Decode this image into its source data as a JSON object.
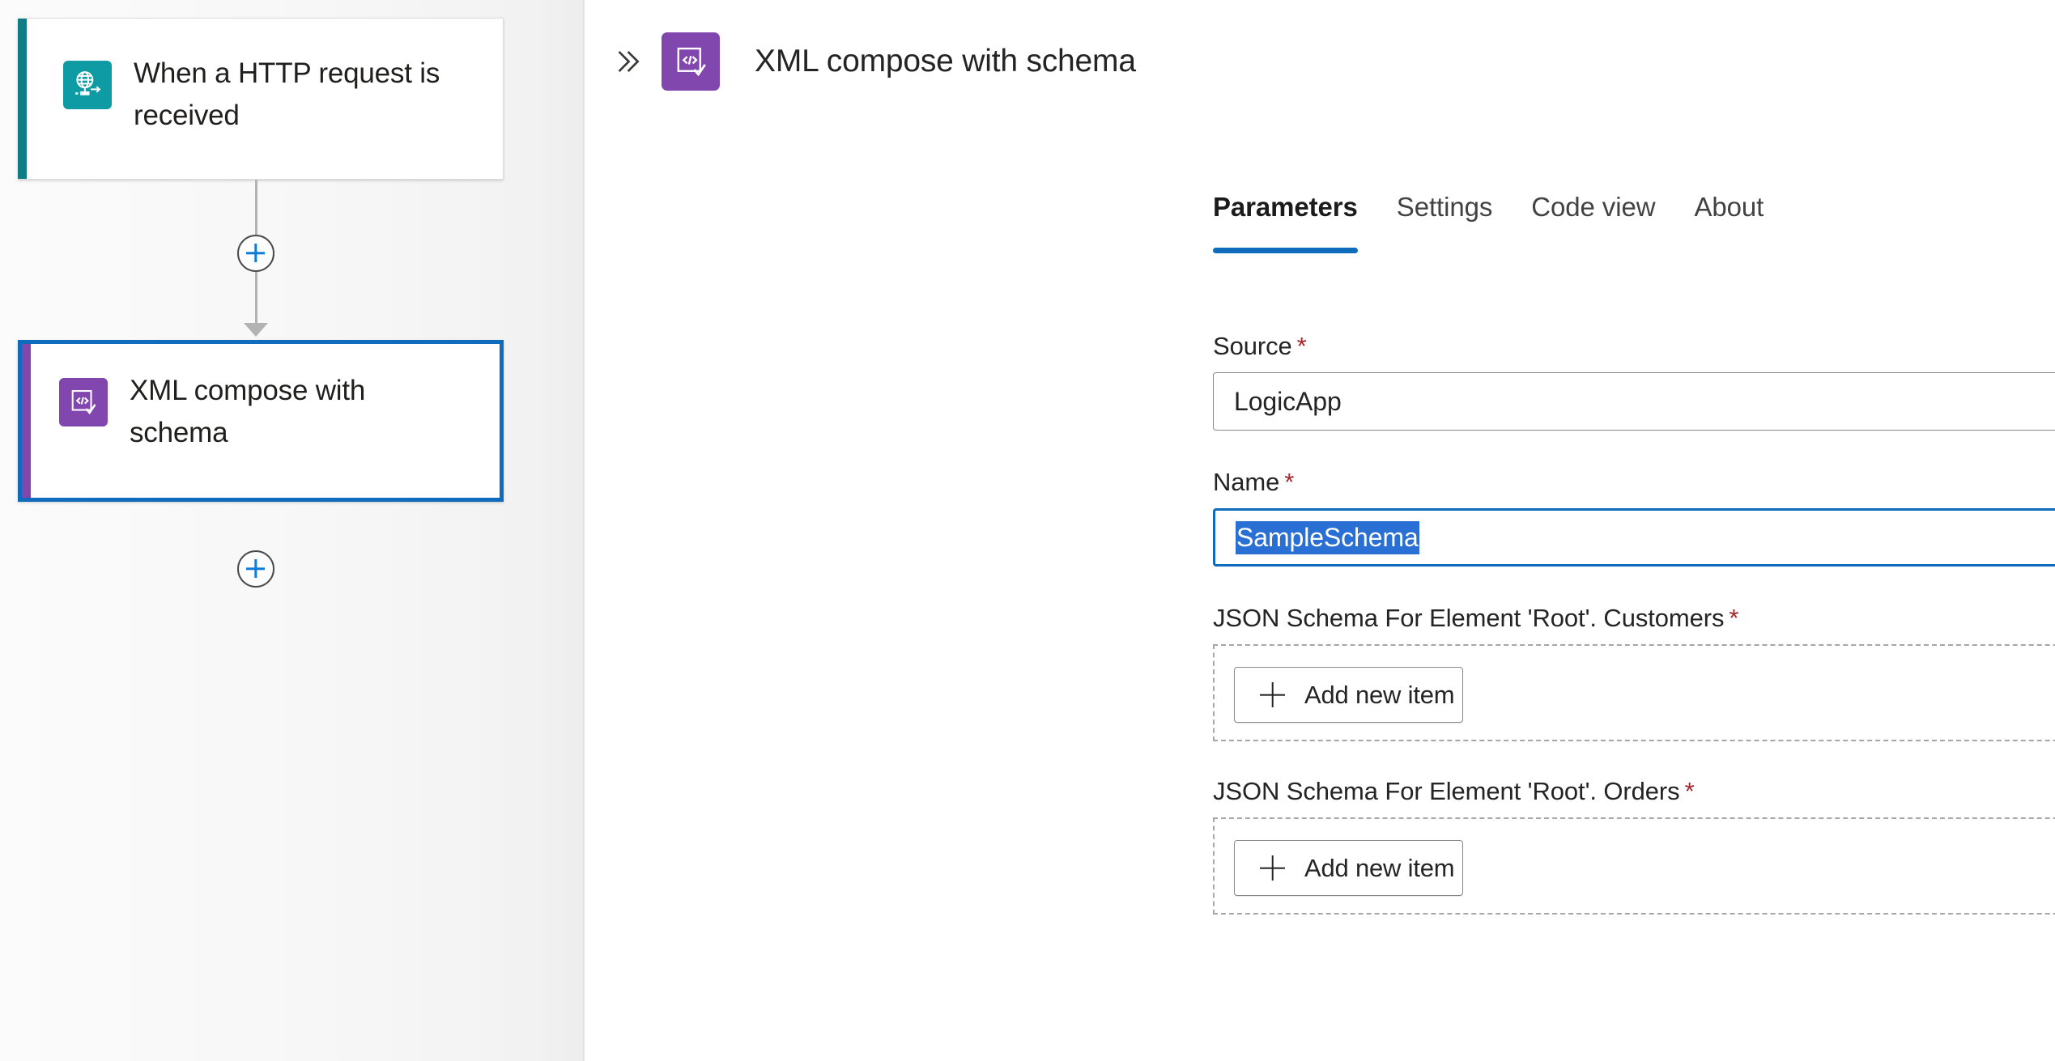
{
  "designer": {
    "nodes": [
      {
        "id": "trigger",
        "title": "When a HTTP request is received",
        "icon": "http-request-globe-icon",
        "accent_color": "#0f7c86",
        "icon_tile_color": "#0f9ba4",
        "selected": false
      },
      {
        "id": "action",
        "title": "XML compose with schema",
        "icon": "xml-compose-code-check-icon",
        "accent_color": "#8246af",
        "icon_tile_color": "#8246af",
        "selected": true
      }
    ],
    "insert_buttons": [
      {
        "name": "insert-node-between-trigger-and-action",
        "label": "+"
      },
      {
        "name": "insert-node-after-action",
        "label": "+"
      }
    ]
  },
  "panel": {
    "collapse_icon": "double-chevron-right-icon",
    "header_icon": "xml-compose-code-check-icon",
    "title": "XML compose with schema",
    "accent_color": "#0f6cbd",
    "tabs": [
      {
        "label": "Parameters",
        "active": true
      },
      {
        "label": "Settings",
        "active": false
      },
      {
        "label": "Code view",
        "active": false
      },
      {
        "label": "About",
        "active": false
      }
    ],
    "fields": [
      {
        "type": "combobox",
        "label": "Source",
        "required": true,
        "required_marker": "*",
        "value": "LogicApp",
        "selected": false,
        "focused": false,
        "chevron_icon": "chevron-down-icon"
      },
      {
        "type": "combobox",
        "label": "Name",
        "required": true,
        "required_marker": "*",
        "value": "SampleSchema",
        "selected": true,
        "focused": true,
        "chevron_icon": "chevron-down-icon"
      },
      {
        "type": "array",
        "label": "JSON Schema For Element 'Root'. Customers",
        "required": true,
        "required_marker": "*",
        "add_button_label": "Add new item",
        "add_button_icon": "plus-icon",
        "dynamic_content_icon": "switch-to-text-mode-icon"
      },
      {
        "type": "array",
        "label": "JSON Schema For Element 'Root'. Orders",
        "required": true,
        "required_marker": "*",
        "add_button_label": "Add new item",
        "add_button_icon": "plus-icon",
        "dynamic_content_icon": "switch-to-text-mode-icon"
      }
    ]
  },
  "colors": {
    "accent_blue": "#0f6cbd",
    "teal": "#0f9ba4",
    "purple": "#8246af",
    "required_red": "#a4262c",
    "selection_blue": "#2a6fd4"
  }
}
